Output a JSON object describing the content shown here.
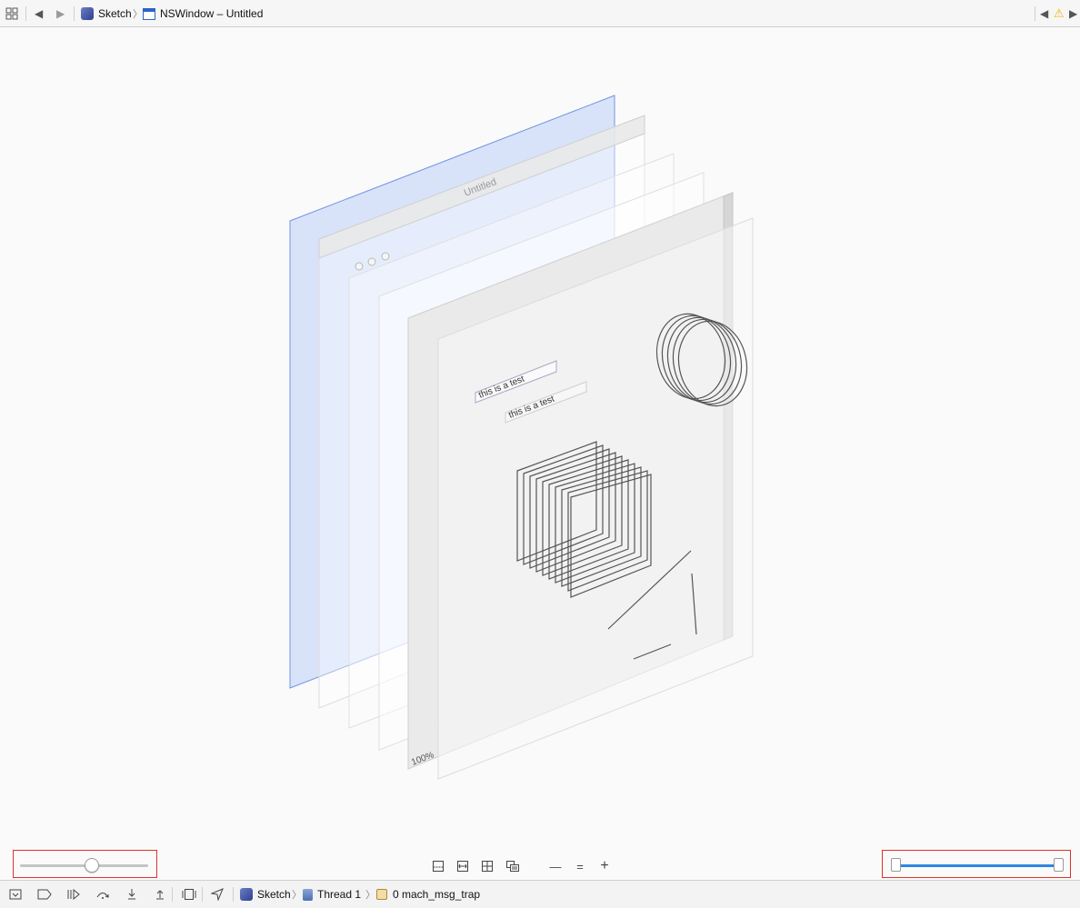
{
  "jump_bar": {
    "app_name": "Sketch",
    "window_name": "NSWindow – Untitled",
    "icons": [
      "related-items-icon",
      "back-icon",
      "forward-icon",
      "previous-issue-icon",
      "warning-icon",
      "next-issue-icon"
    ]
  },
  "scene": {
    "window_title": "Untitled",
    "text_field_1": "this is a test",
    "text_field_2": "this is a test",
    "zoom_label": "100%",
    "selected_layer_color": "#6f95e0"
  },
  "view_controls": {
    "spacing_slider_value": 0.57,
    "range_slider_low": 0.0,
    "range_slider_high": 1.0,
    "accent_color": "#2d86e0",
    "buttons": [
      "show-clipped-content-icon",
      "show-constraints-icon",
      "wireframe-icon",
      "content-icon",
      "zoom-out-icon",
      "zoom-actual-icon",
      "zoom-in-icon"
    ],
    "zoom_out": "—",
    "zoom_actual": "=",
    "zoom_in": "+"
  },
  "debug_bar": {
    "process": "Sketch",
    "thread": "Thread 1",
    "frame": "0 mach_msg_trap",
    "buttons": [
      "hide-debug-area-icon",
      "breakpoints-icon",
      "continue-icon",
      "step-over-icon",
      "step-into-icon",
      "step-out-icon",
      "debug-view-hierarchy-icon",
      "simulate-location-icon"
    ]
  }
}
